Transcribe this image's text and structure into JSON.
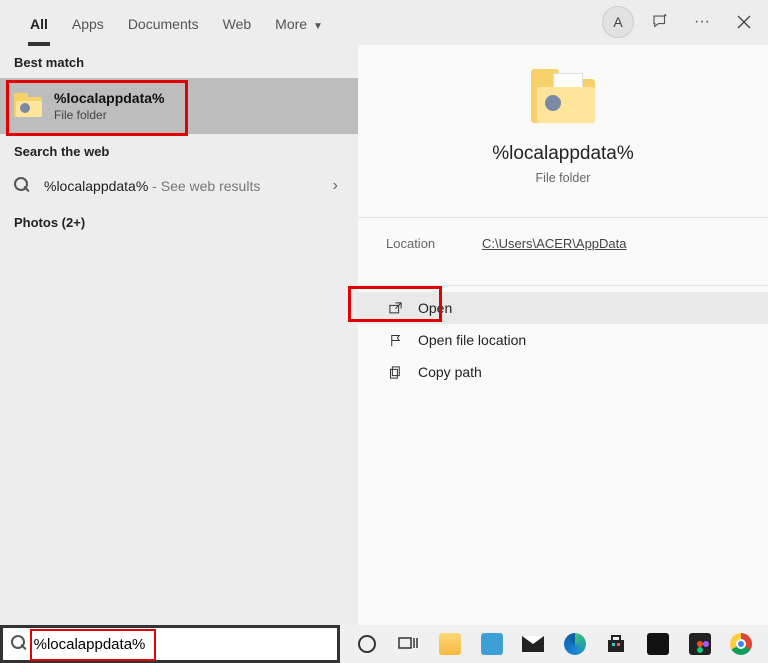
{
  "tabs": {
    "t0": "All",
    "t1": "Apps",
    "t2": "Documents",
    "t3": "Web",
    "t4": "More"
  },
  "avatar_letter": "A",
  "sections": {
    "best_match": "Best match",
    "search_web": "Search the web",
    "photos": "Photos (2+)"
  },
  "best_match": {
    "title": "%localappdata%",
    "subtitle": "File folder"
  },
  "web_result": {
    "query": "%localappdata%",
    "suffix": " - See web results"
  },
  "preview": {
    "title": "%localappdata%",
    "subtitle": "File folder",
    "location_label": "Location",
    "location_value": "C:\\Users\\ACER\\AppData"
  },
  "actions": {
    "open": "Open",
    "open_loc": "Open file location",
    "copy_path": "Copy path"
  },
  "search_value": "%localappdata%"
}
